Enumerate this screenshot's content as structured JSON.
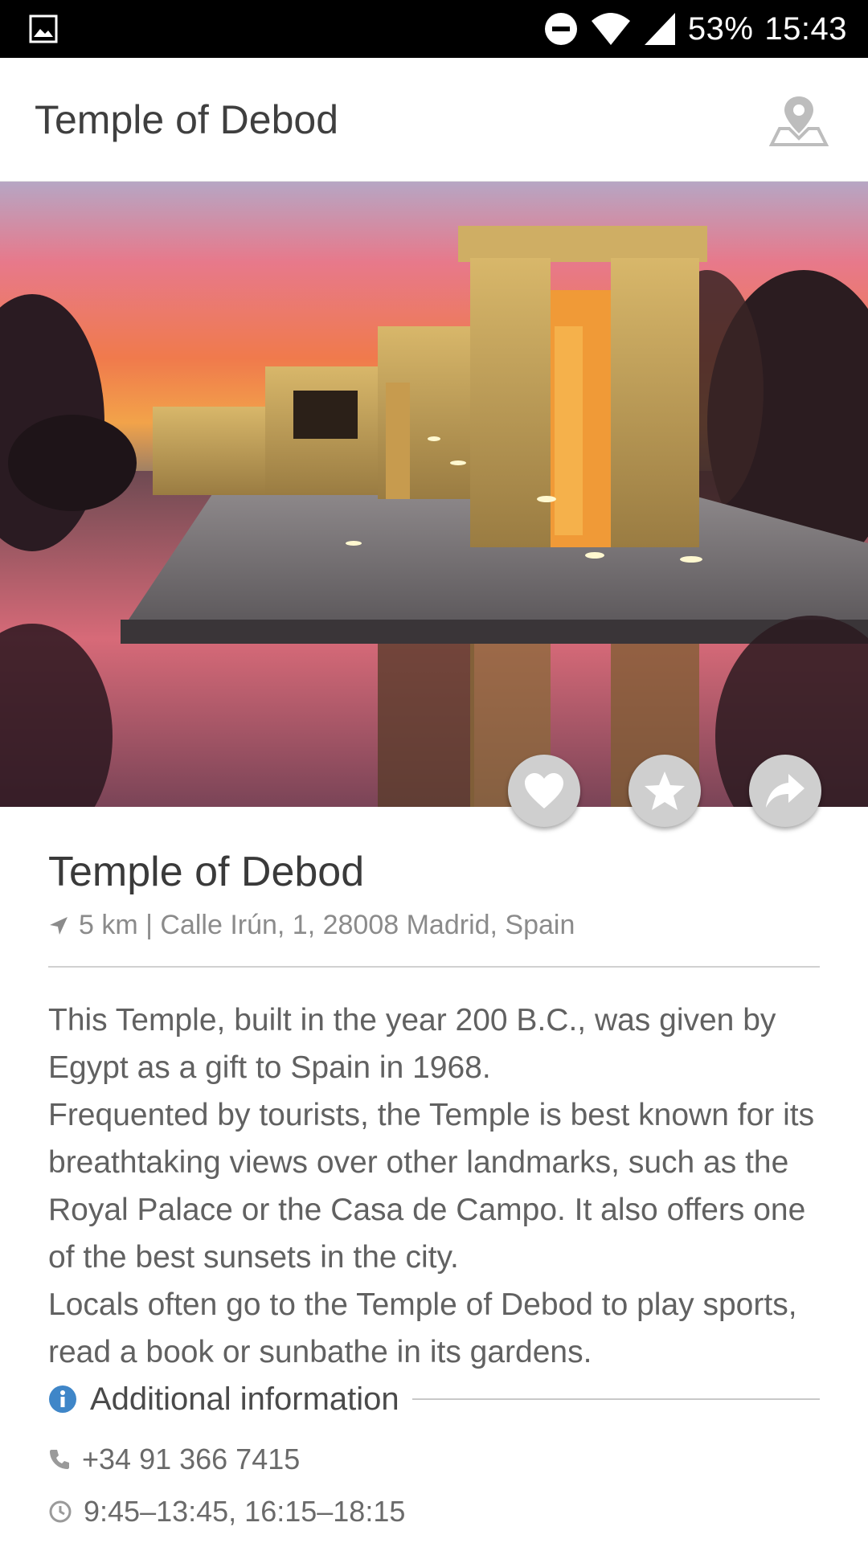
{
  "status_bar": {
    "battery": "53%",
    "time": "15:43"
  },
  "app_bar": {
    "title": "Temple of Debod",
    "map_icon": "map-pin-icon"
  },
  "hero": {
    "image": "sunset-temple-photo"
  },
  "actions": [
    {
      "name": "like",
      "icon": "heart-icon"
    },
    {
      "name": "favorite",
      "icon": "star-icon"
    },
    {
      "name": "share",
      "icon": "share-arrow-icon"
    }
  ],
  "place": {
    "title": "Temple of Debod",
    "meta": "5 km | Calle Irún, 1, 28008 Madrid, Spain",
    "description": [
      "This Temple, built in the year 200 B.C., was given by Egypt as a gift to Spain in 1968.",
      "Frequented by tourists, the Temple is best known for its breathtaking views over other landmarks, such as the Royal Palace or the Casa de Campo. It also offers one of the best sunsets in the city.",
      "Locals often go to the Temple of Debod to play sports, read a book or sunbathe in its gardens."
    ]
  },
  "additional_info": {
    "label": "Additional information",
    "phone": "+34 91 366 7415",
    "hours": "9:45–13:45, 16:15–18:15"
  },
  "colors": {
    "status_bar": "#000000",
    "fab": "#cfcfcf",
    "info_icon": "#3f86c8",
    "text_primary": "#3a3a3a",
    "text_secondary": "#8b8b8b"
  }
}
